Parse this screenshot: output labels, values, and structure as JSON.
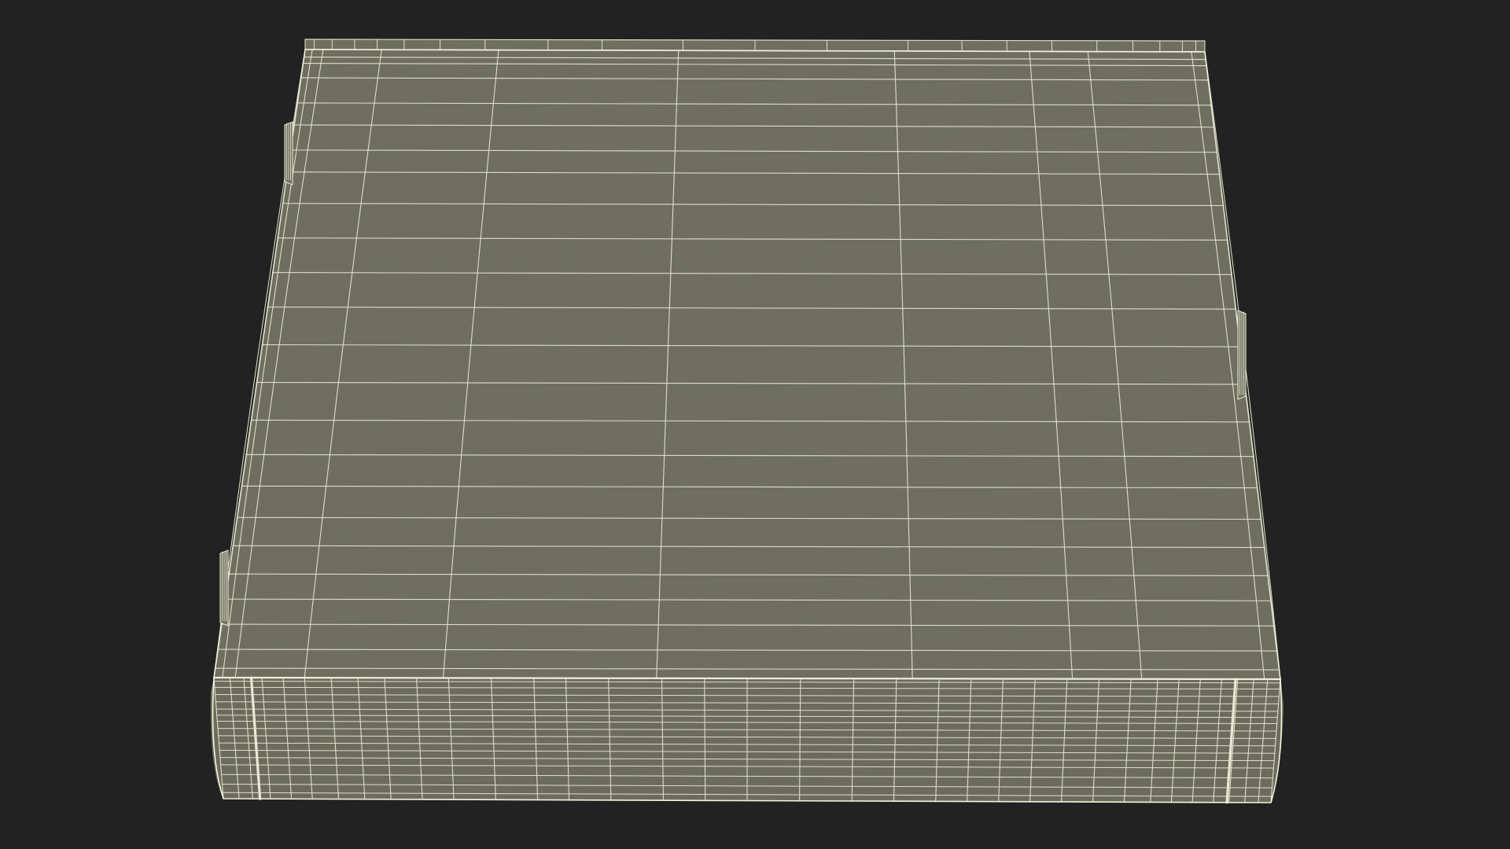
{
  "scene": {
    "subject": "wireframe-hardcover-book",
    "background_color": "#222222",
    "surface_color": "#6e6f5f",
    "spine_color": "#6b6c5c",
    "wire_color": "#e8e8d0",
    "wire_bright_color": "#f4f4e0"
  }
}
